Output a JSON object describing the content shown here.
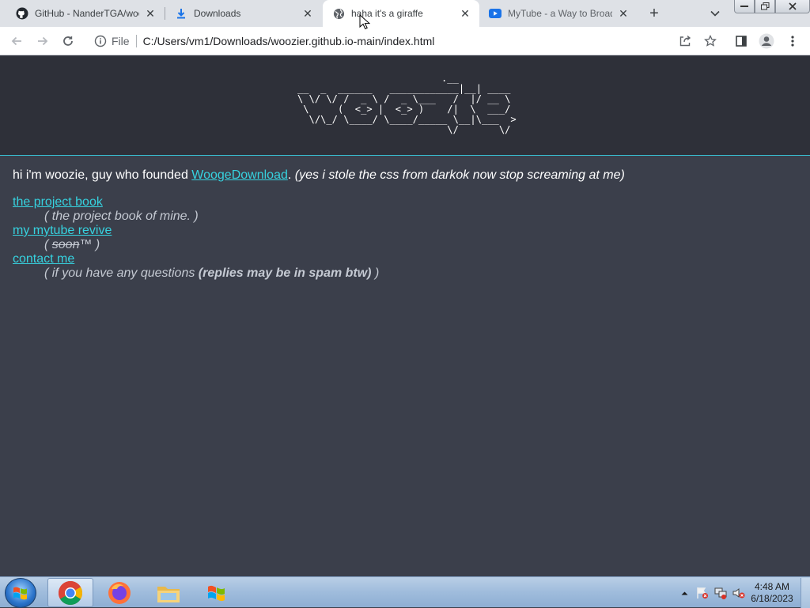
{
  "browser": {
    "tabs": [
      {
        "title": "GitHub - NanderTGA/woo",
        "icon": "github-icon",
        "active": false
      },
      {
        "title": "Downloads",
        "icon": "download-icon",
        "active": false
      },
      {
        "title": "haha it's a giraffe",
        "icon": "globe-icon",
        "active": true
      },
      {
        "title": "MyTube - a Way to Broad",
        "icon": "youtube-icon",
        "active": false
      }
    ],
    "address": {
      "scheme": "File",
      "url": "C:/Users/vm1/Downloads/woozier.github.io-main/index.html"
    }
  },
  "page": {
    "ascii_art": "                         .__ \n__  _  ______   ____________|__| ____  \n\\ \\/ \\/ /  _ \\ /  _ \\___   /  |/ __ \\ \n \\     (  <_> |  <_> )    /|  \\  ___/ \n  \\/\\_/ \\____/ \\____/_____ \\__|\\___  >\n                          \\/       \\/ ",
    "intro_text": "hi i'm woozie, guy who founded ",
    "intro_link": "WoogeDownload",
    "intro_dot": ". ",
    "intro_aside": "(yes i stole the css from darkok now stop screaming at me)",
    "links": [
      {
        "label": "the project book",
        "desc": "( the project book of mine. )"
      },
      {
        "label": "my mytube revive",
        "desc_open": "( ",
        "desc_strike": "soon",
        "desc_close": "™ )"
      },
      {
        "label": "contact me",
        "desc_open": "( if you have any questions ",
        "desc_bold": "(replies may be in spam btw)",
        "desc_close": " )"
      }
    ]
  },
  "taskbar": {
    "clock_time": "4:48 AM",
    "clock_date": "6/18/2023"
  },
  "colors": {
    "page_bg": "#3b3f4b",
    "banner_bg": "#2e3039",
    "link": "#36d2df",
    "accent_line": "#38bfd2"
  }
}
